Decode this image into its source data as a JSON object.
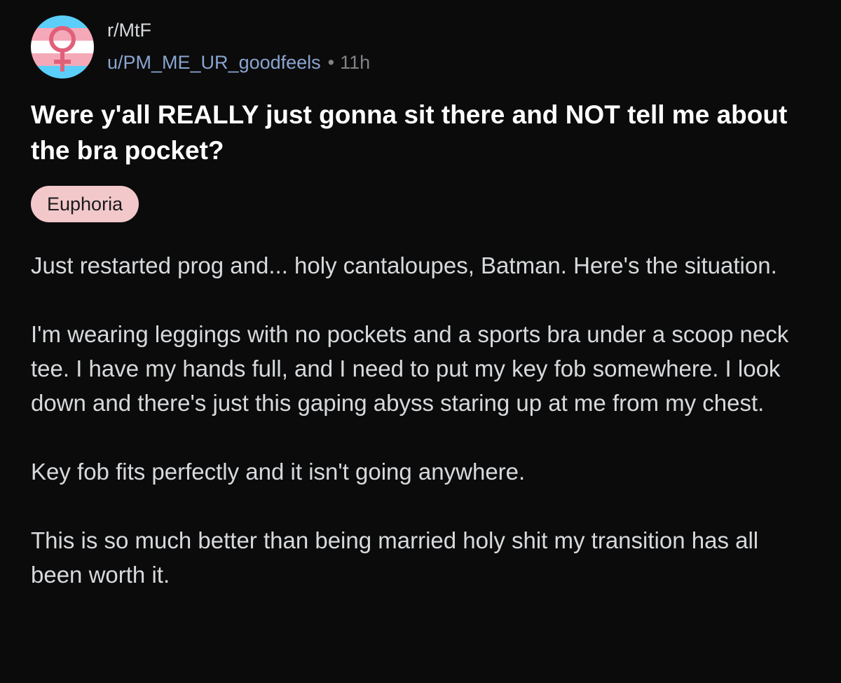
{
  "post": {
    "subreddit": "r/MtF",
    "author": "u/PM_ME_UR_goodfeels",
    "separator": "•",
    "age": "11h",
    "title": "Were y'all REALLY just gonna sit there and NOT tell me about the bra pocket?",
    "flair": "Euphoria",
    "paragraphs": [
      "Just restarted prog and... holy cantaloupes, Batman. Here's the situation.",
      "I'm wearing leggings with no pockets and a sports bra under a scoop neck tee. I have my hands full, and I need to put my key fob somewhere. I look down and there's just this gaping abyss staring up at me from my chest.",
      "Key fob fits perfectly and it isn't going anywhere.",
      "This is so much better than being married holy shit my transition has all been worth it."
    ]
  },
  "avatar": {
    "icon": "venus-symbol-icon",
    "stripe_colors": [
      "#5bcefa",
      "#f5a9b8",
      "#ffffff",
      "#f5a9b8",
      "#5bcefa"
    ],
    "symbol_color": "#e0607a"
  },
  "colors": {
    "background": "#0b0b0c",
    "author_link": "#8aa5cf",
    "flair_background": "#f2c8cb"
  }
}
